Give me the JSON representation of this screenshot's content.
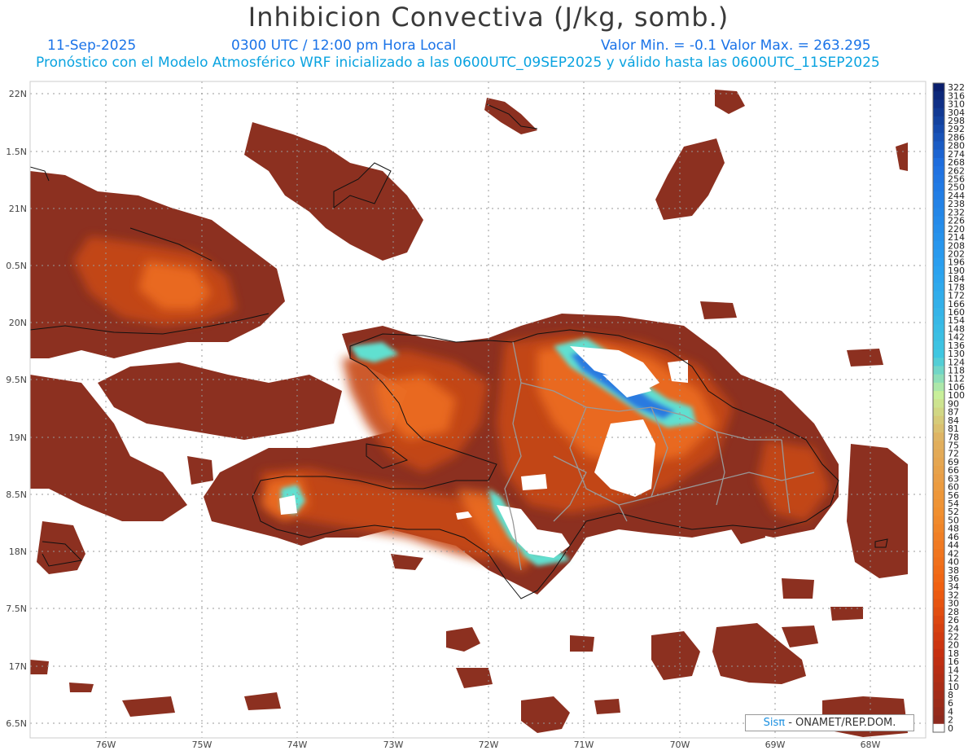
{
  "header": {
    "title": "Inhibicion Convectiva (J/kg, somb.)",
    "date": "11-Sep-2025",
    "time": "0300 UTC / 12:00 pm Hora Local",
    "minmax": "Valor Min. = -0.1  Valor Max. = 263.295",
    "forecast": "Pronóstico con el Modelo Atmosférico WRF inicializado a las 0600UTC_09SEP2025 y válido hasta las  0600UTC_11SEP2025"
  },
  "axes": {
    "lat_labels": [
      "22N",
      "1.5N",
      "21N",
      "0.5N",
      "20N",
      "9.5N",
      "19N",
      "8.5N",
      "18N",
      "7.5N",
      "17N",
      "6.5N"
    ],
    "lon_labels": [
      "76W",
      "75W",
      "74W",
      "73W",
      "72W",
      "71W",
      "70W",
      "69W",
      "68W"
    ]
  },
  "colorbar": {
    "labels": [
      "322",
      "316",
      "310",
      "304",
      "298",
      "292",
      "286",
      "280",
      "274",
      "268",
      "262",
      "256",
      "250",
      "244",
      "238",
      "232",
      "226",
      "220",
      "214",
      "208",
      "202",
      "196",
      "190",
      "184",
      "178",
      "172",
      "166",
      "160",
      "154",
      "148",
      "142",
      "136",
      "130",
      "124",
      "118",
      "112",
      "106",
      "100",
      "90",
      "87",
      "84",
      "81",
      "78",
      "75",
      "72",
      "69",
      "66",
      "63",
      "60",
      "56",
      "54",
      "52",
      "50",
      "48",
      "46",
      "44",
      "42",
      "40",
      "38",
      "36",
      "34",
      "32",
      "30",
      "28",
      "26",
      "24",
      "22",
      "20",
      "18",
      "16",
      "14",
      "12",
      "10",
      "8",
      "6",
      "4",
      "2",
      "0"
    ],
    "colors": {
      "top": "#0a1f6e",
      "blue": "#1f6fe0",
      "cyan": "#40c8e0",
      "green": "#c8ef9a",
      "tan": "#e0b060",
      "orange": "#f06010",
      "red": "#c83010",
      "darkred": "#8c2a1e",
      "zero": "#ffffff"
    }
  },
  "field_colors": {
    "base": "#8c3020",
    "mid": "#c84a18",
    "orange": "#f07020",
    "light": "#f4b070",
    "cyan": "#60e0d0",
    "blue": "#2a7ae0",
    "coast": "#111111",
    "border": "#999999"
  },
  "credit": {
    "brand": "Sisπ",
    "text": " - ONAMET/REP.DOM."
  }
}
